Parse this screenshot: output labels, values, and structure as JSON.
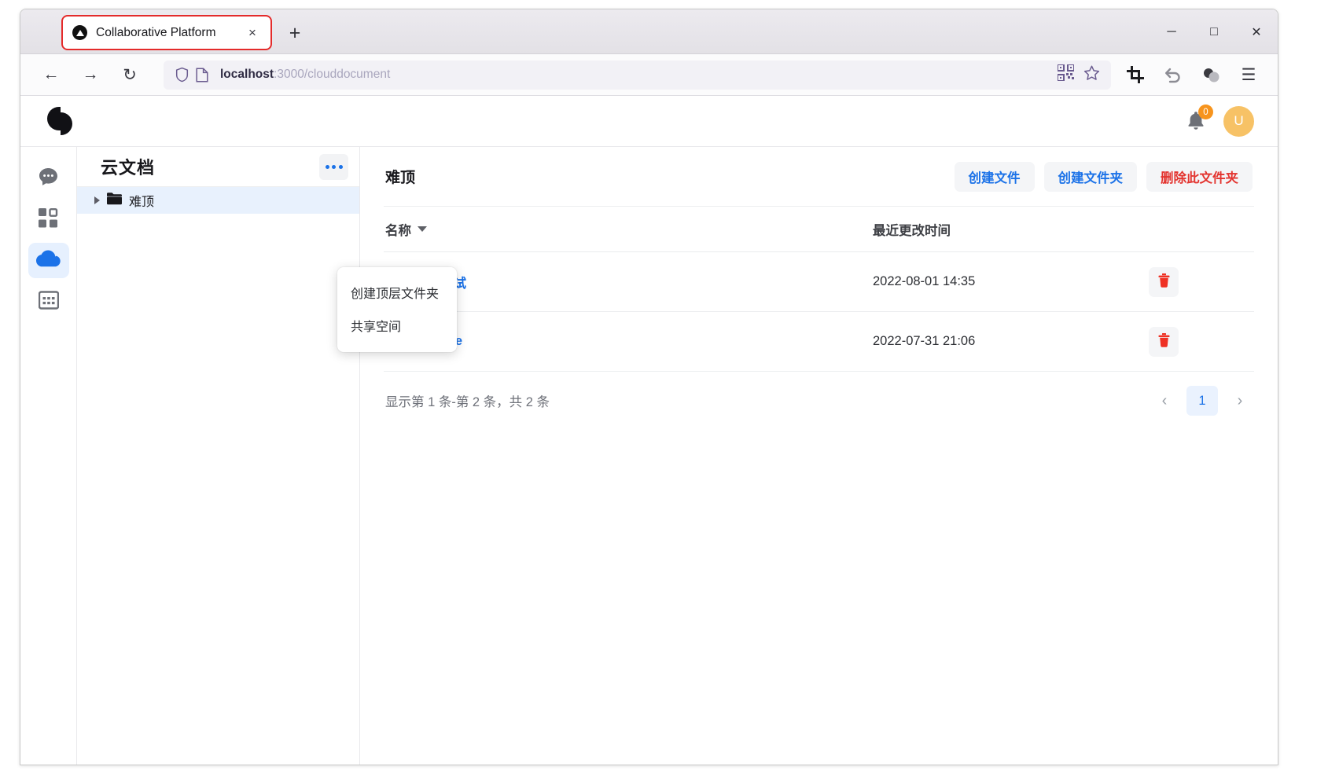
{
  "browser": {
    "tab": {
      "title": "Collaborative Platform",
      "favicon": "triangle-logo-icon",
      "close": "×"
    },
    "newtab_label": "+",
    "window_controls": {
      "minimize": "─",
      "maximize": "□",
      "close": "✕"
    },
    "nav": {
      "back": "←",
      "forward": "→",
      "reload": "↻"
    },
    "url": {
      "host": "localhost",
      "rest": ":3000/clouddocument"
    },
    "toolbar_right": {
      "qr": "qr-code-icon",
      "bookmark": "☆",
      "screenshot": "crop-icon",
      "undo": "↩",
      "extensions": "extensions-icon",
      "menu": "☰"
    }
  },
  "appbar": {
    "logo": "brand-logo",
    "notifications_count": "0",
    "avatar_initial": "U"
  },
  "rail": {
    "items": [
      {
        "name": "chat",
        "icon": "chat-bubble-icon",
        "active": false
      },
      {
        "name": "apps",
        "icon": "grid-apps-icon",
        "active": false
      },
      {
        "name": "cloud",
        "icon": "cloud-icon",
        "active": true
      },
      {
        "name": "calendar",
        "icon": "calendar-icon",
        "active": false
      }
    ]
  },
  "tree": {
    "title": "云文档",
    "more_button": "more-options",
    "nodes": [
      {
        "label": "难顶",
        "expanded": false,
        "selected": true
      }
    ]
  },
  "dropdown": {
    "items": [
      {
        "label": "创建顶层文件夹"
      },
      {
        "label": "共享空间"
      }
    ]
  },
  "main": {
    "title": "难顶",
    "actions": [
      {
        "label": "创建文件",
        "style": "primary"
      },
      {
        "label": "创建文件夹",
        "style": "primary"
      },
      {
        "label": "删除此文件夹",
        "style": "danger"
      }
    ],
    "table": {
      "columns": {
        "name": "名称",
        "modified": "最近更改时间",
        "actions": ""
      },
      "rows": [
        {
          "icon": "folder-icon",
          "name": "测试",
          "modified": "2022-08-01 14:35",
          "delete": "trash-icon"
        },
        {
          "icon": "file-icon",
          "name": "qwe",
          "modified": "2022-07-31 21:06",
          "delete": "trash-icon"
        }
      ]
    },
    "pagination": {
      "summary": "显示第 1 条-第 2 条，共 2 条",
      "prev": "‹",
      "current_page": "1",
      "next": "›"
    }
  },
  "colors": {
    "accent_blue": "#1b72e8",
    "danger_red": "#e3342f",
    "avatar_orange": "#f7c266",
    "badge_orange": "#f7941d"
  }
}
